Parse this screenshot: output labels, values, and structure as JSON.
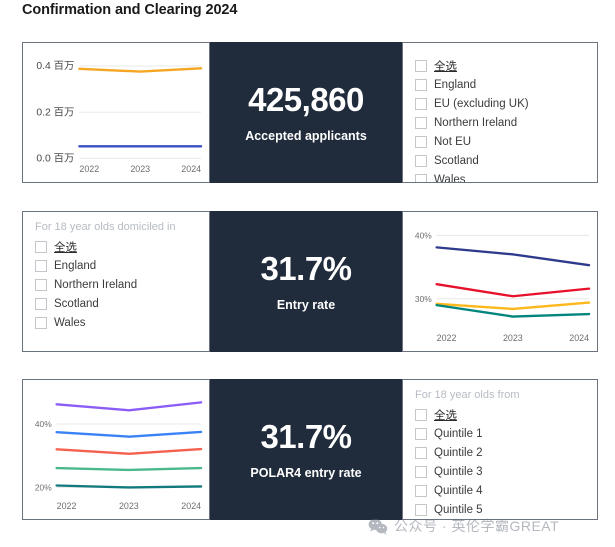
{
  "page": {
    "title": "Confirmation and Clearing 2024"
  },
  "watermark": {
    "icon": "wechat-icon",
    "text": "公众号 · 英伦学霸GREAT"
  },
  "row1": {
    "kpi": {
      "value": "425,860",
      "label": "Accepted applicants"
    },
    "filters": {
      "header": "",
      "items": [
        {
          "label": "全选",
          "checked": false,
          "is_all": true
        },
        {
          "label": "England",
          "checked": false
        },
        {
          "label": "EU (excluding UK)",
          "checked": false
        },
        {
          "label": "Northern Ireland",
          "checked": false
        },
        {
          "label": "Not EU",
          "checked": false
        },
        {
          "label": "Scotland",
          "checked": false
        },
        {
          "label": "Wales",
          "checked": false
        }
      ]
    }
  },
  "row2": {
    "kpi": {
      "value": "31.7%",
      "label": "Entry rate"
    },
    "filters": {
      "header": "For 18 year olds domiciled in",
      "items": [
        {
          "label": "全选",
          "checked": false,
          "is_all": true
        },
        {
          "label": "England",
          "checked": false
        },
        {
          "label": "Northern Ireland",
          "checked": false
        },
        {
          "label": "Scotland",
          "checked": false
        },
        {
          "label": "Wales",
          "checked": false
        }
      ]
    }
  },
  "row3": {
    "kpi": {
      "value": "31.7%",
      "label": "POLAR4 entry rate"
    },
    "filters": {
      "header": "For 18 year olds from",
      "items": [
        {
          "label": "全选",
          "checked": false,
          "is_all": true
        },
        {
          "label": "Quintile 1",
          "checked": false
        },
        {
          "label": "Quintile 2",
          "checked": false
        },
        {
          "label": "Quintile 3",
          "checked": false
        },
        {
          "label": "Quintile 4",
          "checked": false
        },
        {
          "label": "Quintile 5",
          "checked": false
        }
      ]
    }
  },
  "chart_data": [
    {
      "id": "accepted-applicants-chart",
      "type": "line",
      "title": "",
      "xlabel": "",
      "ylabel": "",
      "x": [
        "2022",
        "2023",
        "2024"
      ],
      "ytick_labels": [
        "0.0 百万",
        "0.2 百万",
        "0.4 百万"
      ],
      "ytick_values": [
        0.0,
        0.2,
        0.4
      ],
      "ylim": [
        0.0,
        0.44
      ],
      "grid": true,
      "legend": "none",
      "series": [
        {
          "name": "series-orange",
          "color": "#f5a623",
          "values": [
            0.388,
            0.376,
            0.39
          ]
        },
        {
          "name": "series-blue",
          "color": "#3b4fc4",
          "values": [
            0.052,
            0.052,
            0.052
          ]
        }
      ]
    },
    {
      "id": "entry-rate-chart",
      "type": "line",
      "title": "",
      "xlabel": "",
      "ylabel": "",
      "x": [
        "2022",
        "2023",
        "2024"
      ],
      "ytick_labels": [
        "30%",
        "40%"
      ],
      "ytick_values": [
        30,
        40
      ],
      "ylim": [
        25.5,
        41.5
      ],
      "grid": true,
      "legend": "none",
      "series": [
        {
          "name": "series-navy",
          "color": "#2e3a8c",
          "values": [
            38.1,
            37.0,
            35.3
          ]
        },
        {
          "name": "series-red",
          "color": "#e8112d",
          "values": [
            32.3,
            30.4,
            31.6
          ]
        },
        {
          "name": "series-orange",
          "color": "#ffb81c",
          "values": [
            29.2,
            28.4,
            29.4
          ]
        },
        {
          "name": "series-teal",
          "color": "#00857d",
          "values": [
            29.0,
            27.2,
            27.6
          ]
        }
      ]
    },
    {
      "id": "polar4-entry-rate-chart",
      "type": "line",
      "title": "",
      "xlabel": "",
      "ylabel": "",
      "x": [
        "2022",
        "2023",
        "2024"
      ],
      "ytick_labels": [
        "20%",
        "40%"
      ],
      "ytick_values": [
        20,
        40
      ],
      "ylim": [
        17.5,
        49.5
      ],
      "grid": true,
      "legend": "none",
      "series": [
        {
          "name": "series-purple",
          "color": "#8b5cf6",
          "values": [
            46.2,
            44.3,
            46.8
          ]
        },
        {
          "name": "series-blue",
          "color": "#3b82f6",
          "values": [
            37.4,
            36.0,
            37.5
          ]
        },
        {
          "name": "series-red",
          "color": "#f4614e",
          "values": [
            32.0,
            30.6,
            32.1
          ]
        },
        {
          "name": "series-green",
          "color": "#4ab88a",
          "values": [
            26.1,
            25.5,
            26.1
          ]
        },
        {
          "name": "series-teal",
          "color": "#127a7c",
          "values": [
            20.6,
            20.0,
            20.3
          ]
        }
      ]
    }
  ]
}
